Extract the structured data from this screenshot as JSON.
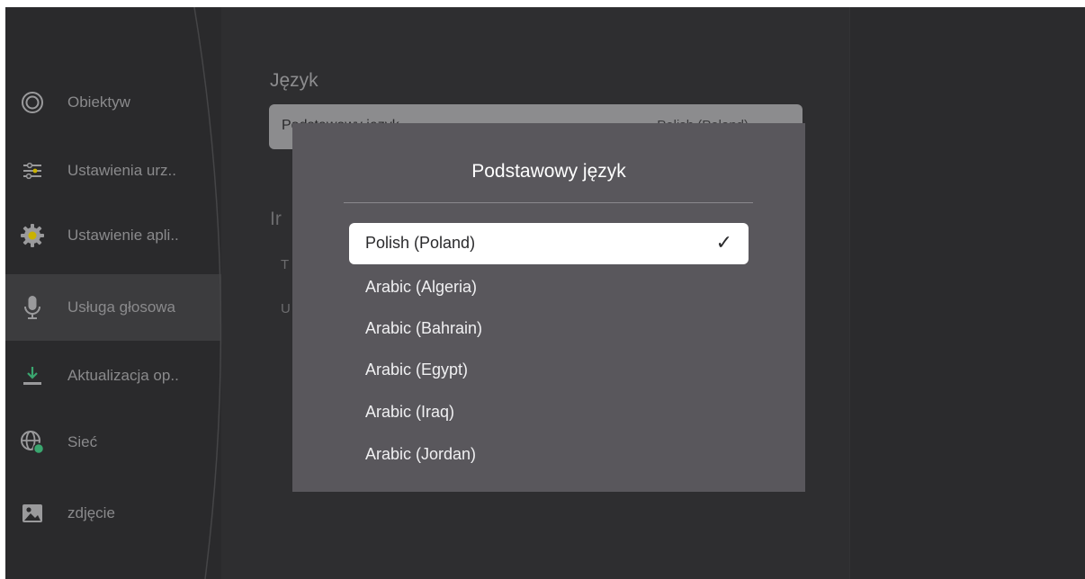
{
  "sidebar": {
    "items": [
      {
        "label": "Obiektyw",
        "icon": "lens-icon"
      },
      {
        "label": "Ustawienia urz..",
        "icon": "sliders-icon"
      },
      {
        "label": "Ustawienie apli..",
        "icon": "gear-icon"
      },
      {
        "label": "Usługa głosowa",
        "icon": "microphone-icon",
        "active": true
      },
      {
        "label": "Aktualizacja op..",
        "icon": "download-icon"
      },
      {
        "label": "Sieć",
        "icon": "globe-icon"
      },
      {
        "label": "zdjęcie",
        "icon": "image-icon"
      }
    ]
  },
  "main": {
    "section_title": "Język",
    "setting_label": "Podstawowy język",
    "setting_value": "Polish (Poland)",
    "section2_title": "Ir",
    "row1": "T",
    "row2": "U"
  },
  "dialog": {
    "title": "Podstawowy język",
    "options": [
      {
        "label": "Polish (Poland)",
        "selected": true
      },
      {
        "label": "Arabic (Algeria)"
      },
      {
        "label": "Arabic (Bahrain)"
      },
      {
        "label": "Arabic (Egypt)"
      },
      {
        "label": "Arabic (Iraq)"
      },
      {
        "label": "Arabic (Jordan)"
      }
    ],
    "check_mark": "✓"
  },
  "colors": {
    "background": "#2e2e30",
    "dialog": "#59575c",
    "accent_yellow": "#c9b200",
    "accent_green": "#3aa66f"
  }
}
